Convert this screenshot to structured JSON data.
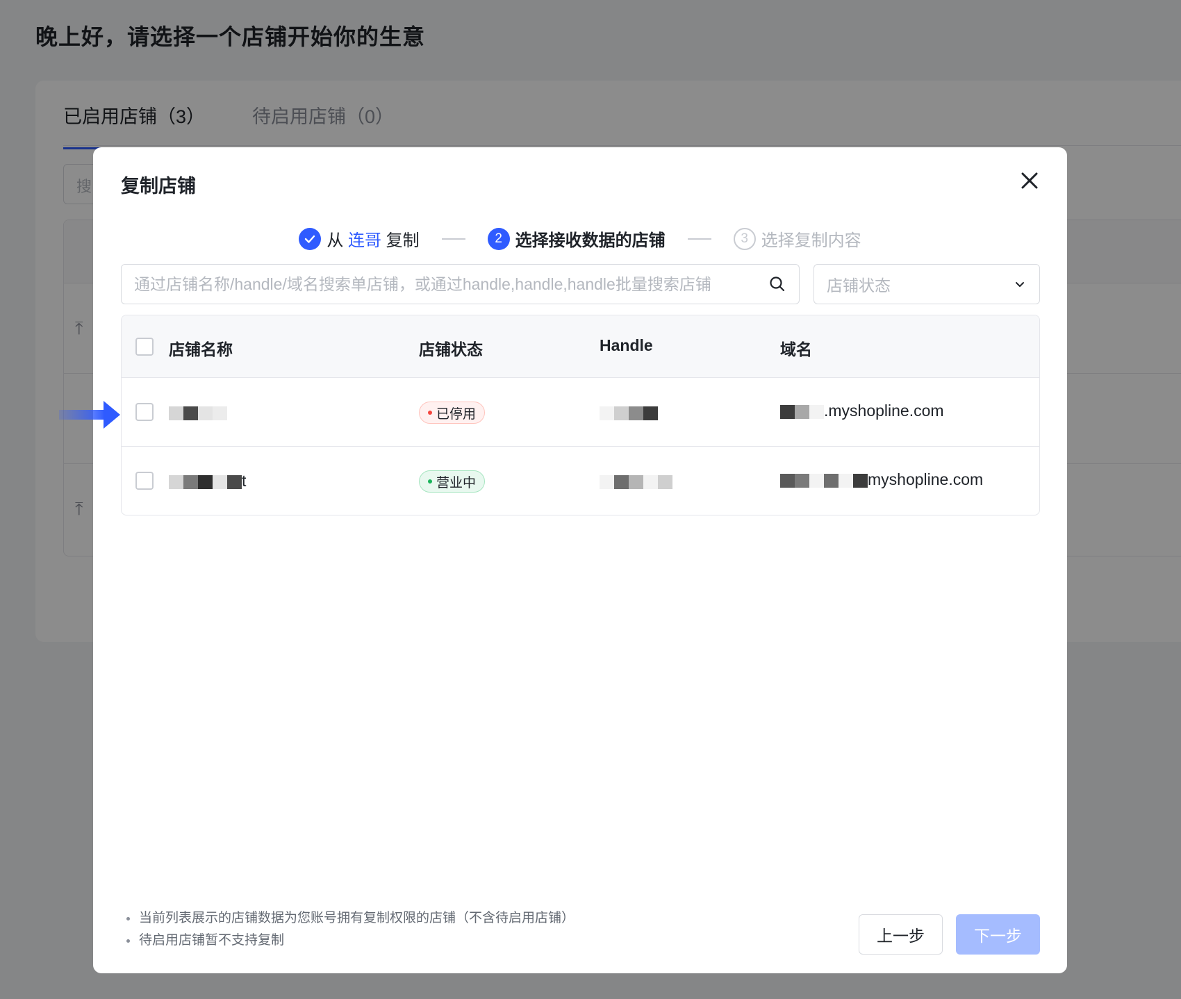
{
  "background": {
    "greeting": "晚上好，请选择一个店铺开始你的生意",
    "tabs": [
      {
        "label": "已启用店铺（3）",
        "active": true
      },
      {
        "label": "待启用店铺（0）",
        "active": false
      }
    ],
    "search_placeholder": "搜"
  },
  "modal": {
    "title": "复制店铺",
    "close_icon": "close-icon",
    "steps": [
      {
        "number": "✓",
        "prefix": "从",
        "highlight": "连哥",
        "suffix": "复制",
        "state": "done"
      },
      {
        "number": "2",
        "label": "选择接收数据的店铺",
        "state": "active"
      },
      {
        "number": "3",
        "label": "选择复制内容",
        "state": "pending"
      }
    ],
    "search": {
      "placeholder": "通过店铺名称/handle/域名搜索单店铺，或通过handle,handle,handle批量搜索店铺",
      "icon": "search-icon"
    },
    "status_filter": {
      "placeholder": "店铺状态",
      "icon": "chevron-down-icon"
    },
    "table": {
      "columns": [
        "店铺名称",
        "店铺状态",
        "Handle",
        "域名"
      ],
      "rows": [
        {
          "name_suffix": "",
          "status": "已停用",
          "status_type": "stopped",
          "domain_suffix": ".myshopline.com"
        },
        {
          "name_suffix": "t",
          "status": "营业中",
          "status_type": "open",
          "domain_suffix": "myshopline.com"
        }
      ]
    },
    "notes": [
      "当前列表展示的店铺数据为您账号拥有复制权限的店铺（不含待启用店铺）",
      "待启用店铺暂不支持复制"
    ],
    "buttons": {
      "prev": "上一步",
      "next": "下一步"
    }
  },
  "colors": {
    "primary": "#2f5bff",
    "next_disabled": "#a5bcff",
    "stopped": "#f5453d",
    "open": "#19b45a"
  }
}
